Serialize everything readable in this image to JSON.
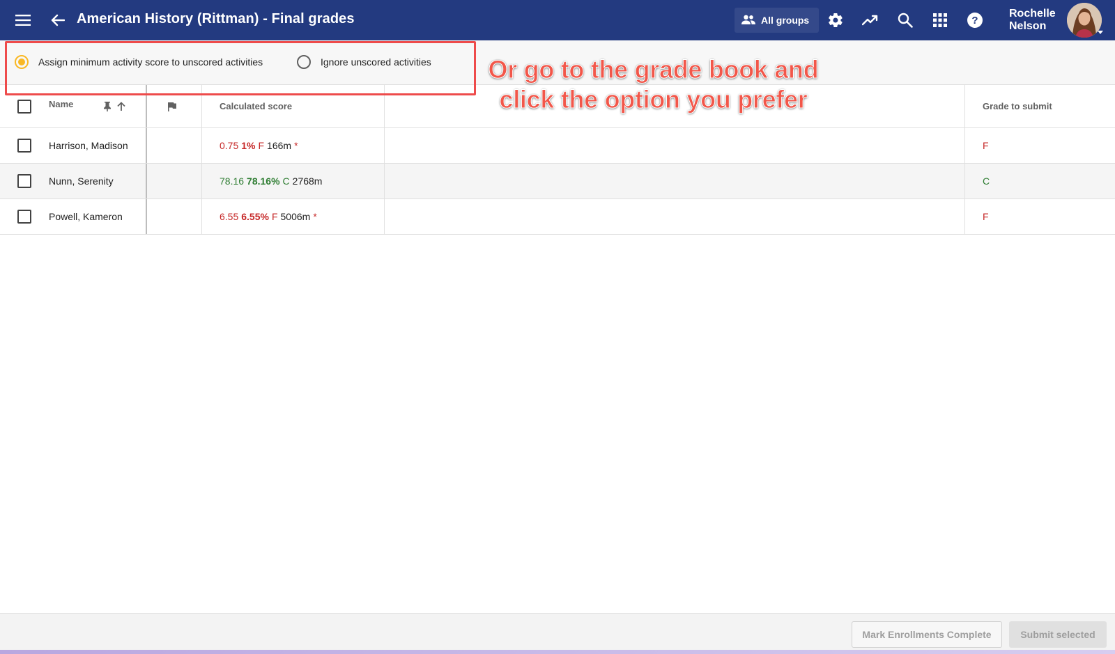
{
  "app": {
    "title": "American History (Rittman) - Final grades",
    "groups_label": "All groups",
    "user": {
      "first": "Rochelle",
      "last": "Nelson"
    },
    "colors": {
      "appbar": "#233a80",
      "accent": "#f9b824",
      "fail": "#c62828",
      "pass": "#2e7d32",
      "annotation": "#f2574a"
    }
  },
  "options": {
    "assign_label": "Assign minimum activity score to unscored activities",
    "ignore_label": "Ignore unscored activities",
    "selected": "assign"
  },
  "annotation": {
    "text": "Or go to the grade book and click the option you prefer"
  },
  "table": {
    "headers": {
      "name": "Name",
      "calculated": "Calculated score",
      "grade": "Grade to submit"
    },
    "rows": [
      {
        "name": "Harrison, Madison",
        "raw": "0.75",
        "pct": "1%",
        "letter": "F",
        "time": "166m",
        "flag": "*",
        "status": "fail",
        "grade": "F"
      },
      {
        "name": "Nunn, Serenity",
        "raw": "78.16",
        "pct": "78.16%",
        "letter": "C",
        "time": "2768m",
        "flag": "",
        "status": "pass",
        "grade": "C"
      },
      {
        "name": "Powell, Kameron",
        "raw": "6.55",
        "pct": "6.55%",
        "letter": "F",
        "time": "5006m",
        "flag": "*",
        "status": "fail",
        "grade": "F"
      }
    ]
  },
  "footer": {
    "mark_complete": "Mark Enrollments Complete",
    "submit_selected": "Submit selected"
  }
}
